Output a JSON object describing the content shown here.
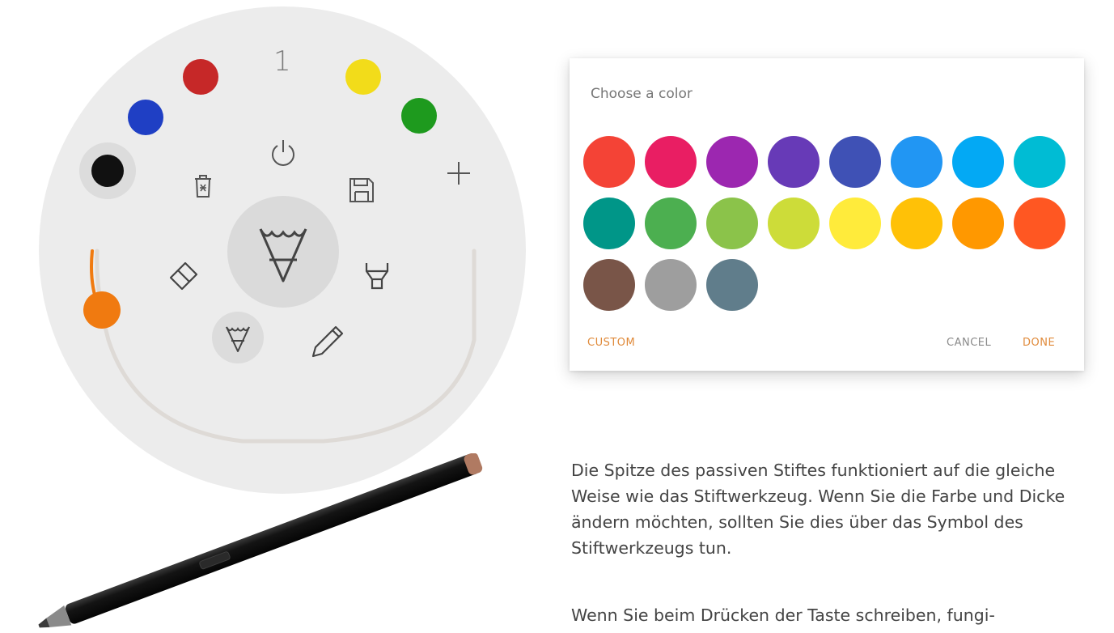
{
  "wheel": {
    "slot_number": "1",
    "colors": {
      "black": "#111111",
      "blue": "#1f3fc4",
      "red": "#c62828",
      "yellow": "#f2dc1a",
      "green": "#1e9a1e"
    },
    "thickness_slider": {
      "handle_color": "#f07a10",
      "track_color": "#dedad6"
    },
    "tools": [
      "power-icon",
      "trash-icon",
      "save-icon",
      "plus-icon",
      "eraser-icon",
      "pen-icon",
      "highlighter-icon",
      "pencil-icon"
    ]
  },
  "dialog": {
    "title": "Choose a color",
    "swatches": [
      "#f44336",
      "#e91e63",
      "#9c27b0",
      "#673ab7",
      "#3f51b5",
      "#2196f3",
      "#03a9f4",
      "#00bcd4",
      "#009688",
      "#4caf50",
      "#8bc34a",
      "#cddc39",
      "#ffeb3b",
      "#ffc107",
      "#ff9800",
      "#ff5722",
      "#795548",
      "#9e9e9e",
      "#607d8b"
    ],
    "buttons": {
      "custom": "CUSTOM",
      "cancel": "CANCEL",
      "done": "DONE"
    }
  },
  "text": {
    "paragraph1": "Die Spitze des passiven Stiftes funktioniert auf die gleiche Weise wie das Stiftwerkzeug. Wenn Sie die Farbe und Dicke ändern möchten, sollten Sie dies über das Symbol des Stiftwerkzeugs tun.",
    "paragraph2": "Wenn Sie beim Drücken der Taste schreiben, fungi-"
  }
}
